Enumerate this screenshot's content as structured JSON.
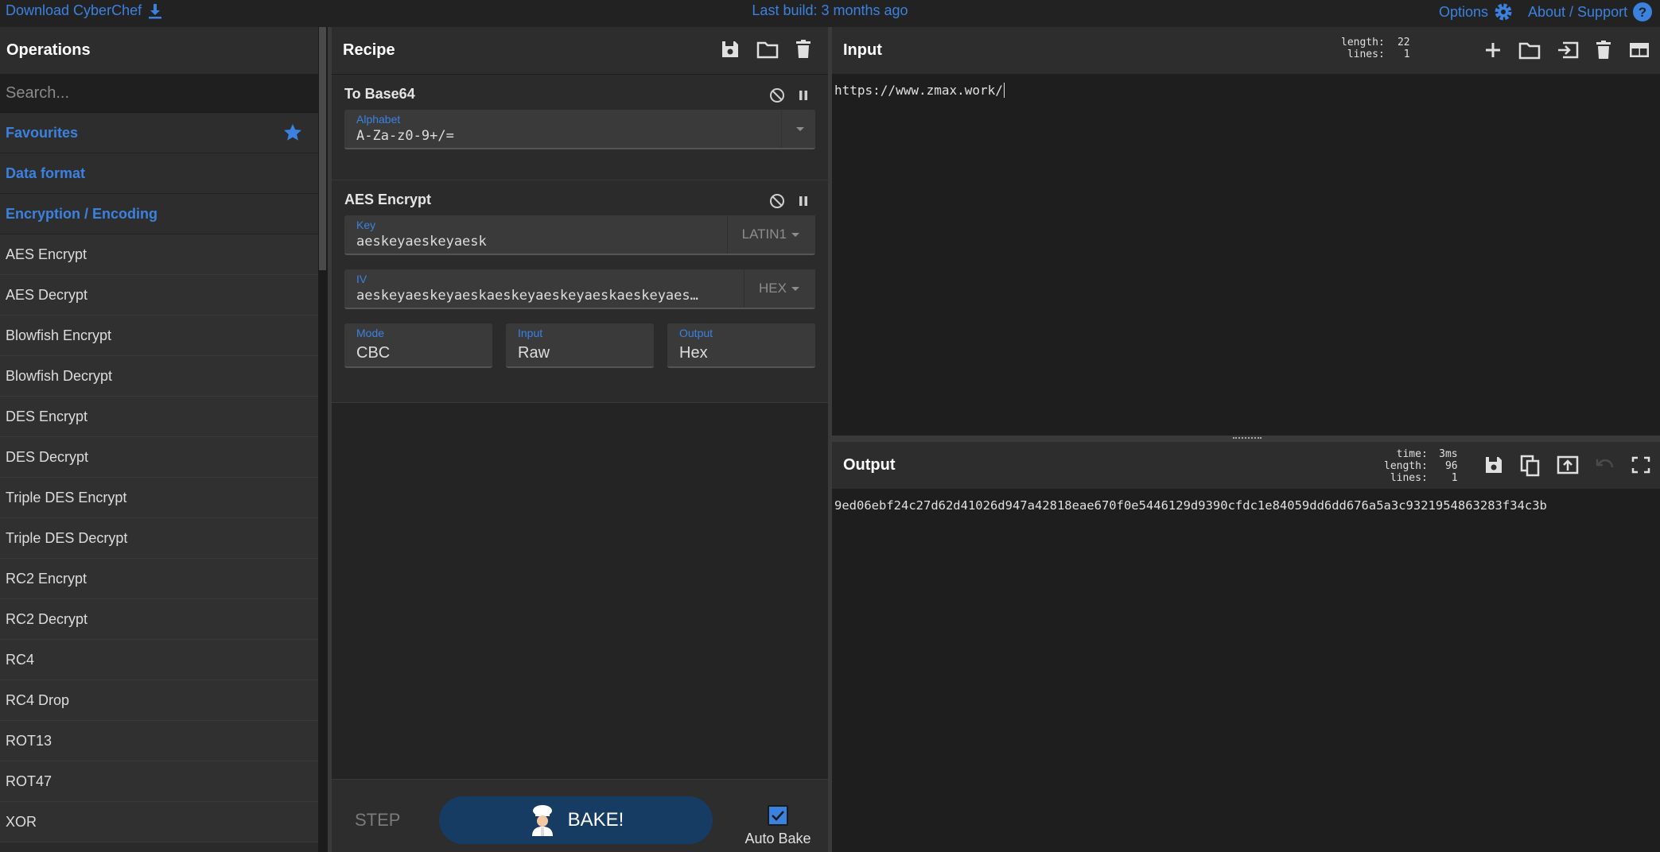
{
  "topbar": {
    "download_label": "Download CyberChef",
    "last_build": "Last build: 3 months ago",
    "options_label": "Options",
    "about_label": "About / Support"
  },
  "operations": {
    "title": "Operations",
    "search_placeholder": "Search...",
    "categories": [
      "Favourites",
      "Data format",
      "Encryption / Encoding"
    ],
    "items": [
      "AES Encrypt",
      "AES Decrypt",
      "Blowfish Encrypt",
      "Blowfish Decrypt",
      "DES Encrypt",
      "DES Decrypt",
      "Triple DES Encrypt",
      "Triple DES Decrypt",
      "RC2 Encrypt",
      "RC2 Decrypt",
      "RC4",
      "RC4 Drop",
      "ROT13",
      "ROT47",
      "XOR"
    ]
  },
  "recipe": {
    "title": "Recipe",
    "ops": [
      {
        "name": "To Base64",
        "alphabet_label": "Alphabet",
        "alphabet_value": "A-Za-z0-9+/="
      },
      {
        "name": "AES Encrypt",
        "key_label": "Key",
        "key_value": "aeskeyaeskeyaesk",
        "key_encoding": "LATIN1",
        "iv_label": "IV",
        "iv_value": "aeskeyaeskeyaeskaeskeyaeskeyaeskaeskeyaes…",
        "iv_encoding": "HEX",
        "mode_label": "Mode",
        "mode_value": "CBC",
        "input_label": "Input",
        "input_value": "Raw",
        "output_label": "Output",
        "output_value": "Hex"
      }
    ],
    "step_label": "STEP",
    "bake_label": "BAKE!",
    "autobake_label": "Auto Bake"
  },
  "input": {
    "title": "Input",
    "stats": {
      "length_label": "length:",
      "length": "22",
      "lines_label": "lines:",
      "lines": "1"
    },
    "text": "https://www.zmax.work/"
  },
  "output": {
    "title": "Output",
    "stats": {
      "time_label": "time:",
      "time": "3ms",
      "length_label": "length:",
      "length": "96",
      "lines_label": "lines:",
      "lines": "1"
    },
    "text": "9ed06ebf24c27d62d41026d947a42818eae670f0e5446129d9390cfdc1e84059dd6dd676a5a3c9321954863283f34c3b"
  },
  "colors": {
    "accent": "#3b82e0",
    "bake": "#173c63"
  }
}
